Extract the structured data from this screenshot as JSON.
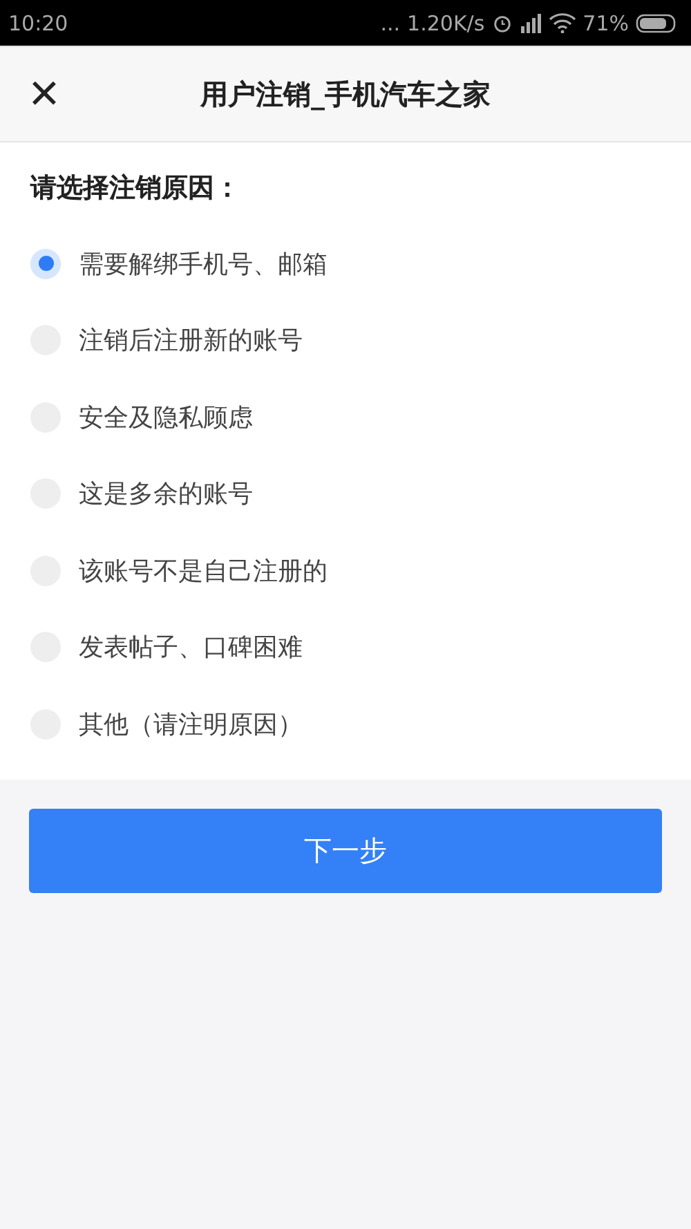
{
  "status_bar": {
    "time": "10:20",
    "dots": "...",
    "speed": "1.20K/s",
    "battery": "71%"
  },
  "header": {
    "close": "×",
    "title": "用户注销_手机汽车之家"
  },
  "question": "请选择注销原因：",
  "reasons": [
    {
      "label": "需要解绑手机号、邮箱",
      "selected": true
    },
    {
      "label": "注销后注册新的账号",
      "selected": false
    },
    {
      "label": "安全及隐私顾虑",
      "selected": false
    },
    {
      "label": "这是多余的账号",
      "selected": false
    },
    {
      "label": "该账号不是自己注册的",
      "selected": false
    },
    {
      "label": "发表帖子、口碑困难",
      "selected": false
    },
    {
      "label": "其他（请注明原因）",
      "selected": false
    }
  ],
  "next_button": "下一步"
}
